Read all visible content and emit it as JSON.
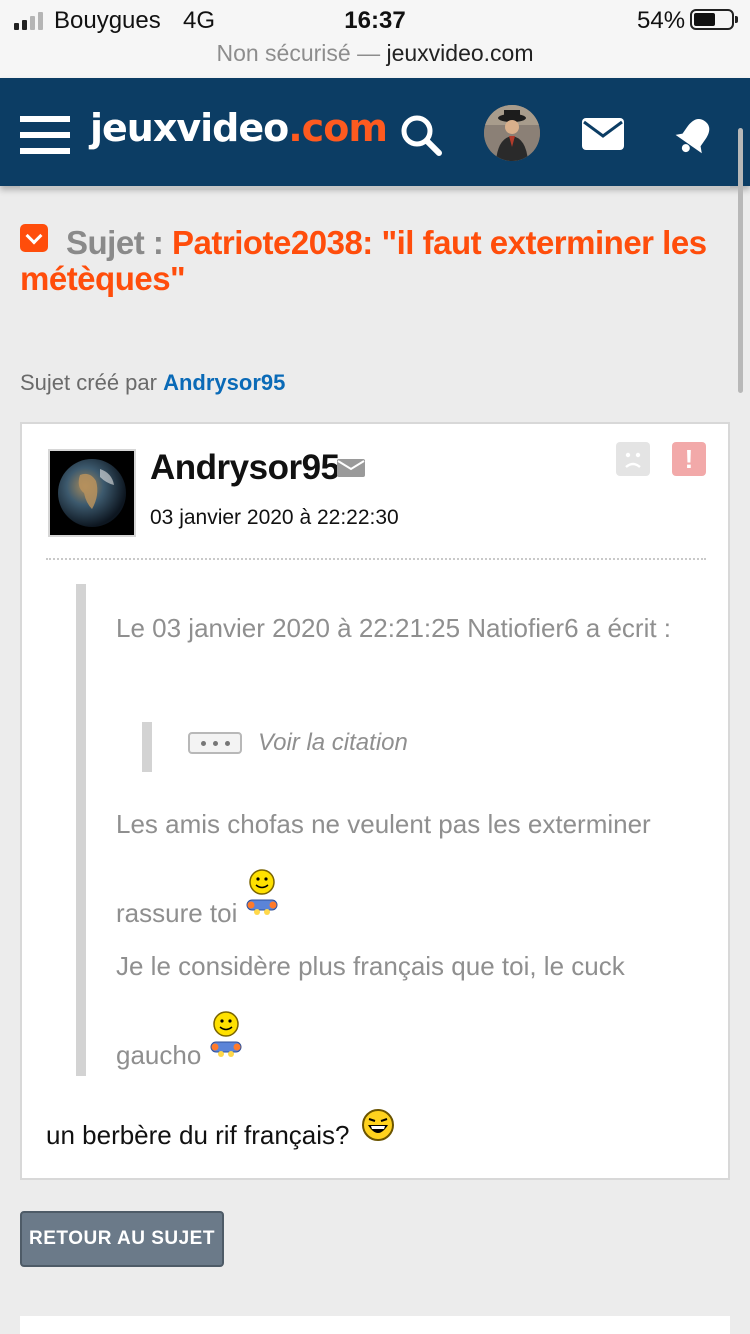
{
  "status_bar": {
    "carrier": "Bouygues",
    "network": "4G",
    "time": "16:37",
    "battery_percent": "54%",
    "battery_level": 0.54,
    "signal_bars": 2
  },
  "url_bar": {
    "security_label": "Non sécurisé —",
    "domain": "jeuxvideo.com"
  },
  "header": {
    "logo_main": "jeuxvideo",
    "logo_tld": ".com",
    "icons": [
      "menu-icon",
      "search-icon",
      "user-avatar",
      "mail-icon",
      "bell-icon"
    ],
    "colors": {
      "background": "#0c3d64",
      "accent": "#ff5a1f"
    }
  },
  "topic": {
    "prefix": "Sujet :",
    "title": "Patriote2038: \"il faut exterminer les métèques\"",
    "created_by_label": "Sujet créé par",
    "created_by_author": "Andrysor95",
    "colors": {
      "title": "#ff4d0b",
      "author_link": "#0a6ab7"
    }
  },
  "post": {
    "author": "Andrysor95",
    "date": "03 janvier 2020 à 22:22:30",
    "quote": {
      "header": "Le 03 janvier 2020 à 22:21:25 Natiofier6 a écrit :",
      "nested_toggle_label": "Voir la citation",
      "paragraph1_line1": "Les amis chofas ne veulent pas les exterminer",
      "paragraph1_line2": "rassure toi",
      "paragraph2_line1": "Je le considère plus français que toi, le cuck",
      "paragraph2_line2": "gaucho"
    },
    "body": "un berbère du rif français?",
    "icons": [
      "private-message-icon",
      "kick-icon",
      "report-icon",
      "smiley-icon",
      "laughing-smiley-icon"
    ]
  },
  "actions": {
    "back_button": "RETOUR AU SUJET"
  }
}
